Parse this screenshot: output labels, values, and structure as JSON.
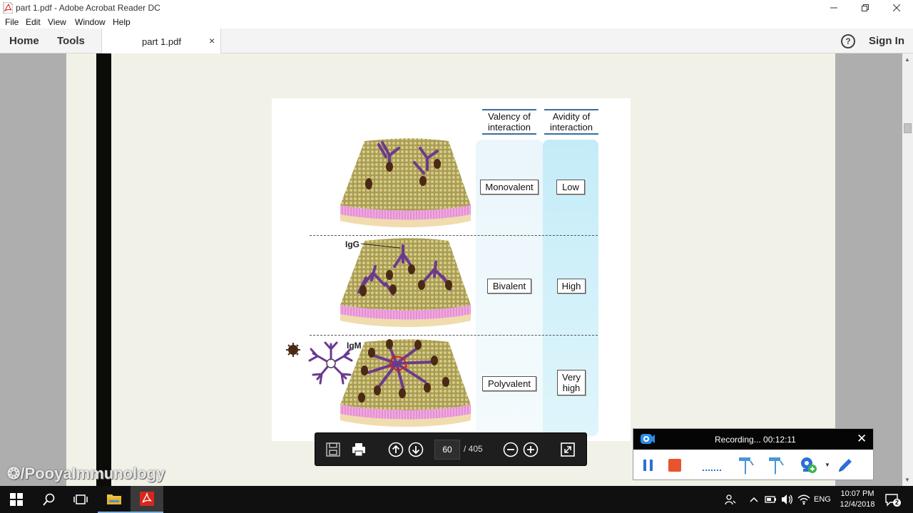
{
  "window": {
    "title": "part 1.pdf - Adobe Acrobat Reader DC",
    "controls": [
      "minimize",
      "restore",
      "close"
    ]
  },
  "menu": [
    "File",
    "Edit",
    "View",
    "Window",
    "Help"
  ],
  "tabs": {
    "home": "Home",
    "tools": "Tools",
    "document": "part 1.pdf",
    "close_glyph": "×",
    "help_glyph": "?",
    "sign_in": "Sign In"
  },
  "figure": {
    "col_headers": [
      {
        "line1": "Valency of",
        "line2": "interaction"
      },
      {
        "line1": "Avidity of",
        "line2": "interaction"
      }
    ],
    "rows": [
      {
        "valency": "Monovalent",
        "avidity": "Low"
      },
      {
        "valency": "Bivalent",
        "avidity": "High"
      },
      {
        "valency": "Polyvalent",
        "avidity_line1": "Very",
        "avidity_line2": "high"
      }
    ],
    "labels": {
      "igg": "IgG",
      "igm": "IgM"
    }
  },
  "floating_toolbar": {
    "current_page": "60",
    "page_total": "/ 405",
    "icons": [
      "save-icon",
      "print-icon",
      "prev-page-icon",
      "next-page-icon",
      "zoom-out-icon",
      "zoom-in-icon",
      "fit-page-icon"
    ]
  },
  "recorder": {
    "status": "Recording... 00:12:11",
    "icons": [
      "pause-icon",
      "stop-icon",
      "dotted-line-icon",
      "pen-icon",
      "highlighter-icon",
      "webcam-icon",
      "draw-icon"
    ]
  },
  "watermark": "/PooyaImmunology",
  "taskbar": {
    "language": "ENG",
    "time": "10:07 PM",
    "date": "12/4/2018",
    "notification_count": "2"
  },
  "colors": {
    "membrane_top": "#b8ae62",
    "membrane_pink": "#e79bd6",
    "antibody": "#6b3a8e",
    "antigen": "#4a2a14",
    "avidity_column": "#c4ecf8",
    "header_rule": "#3a6da0"
  }
}
